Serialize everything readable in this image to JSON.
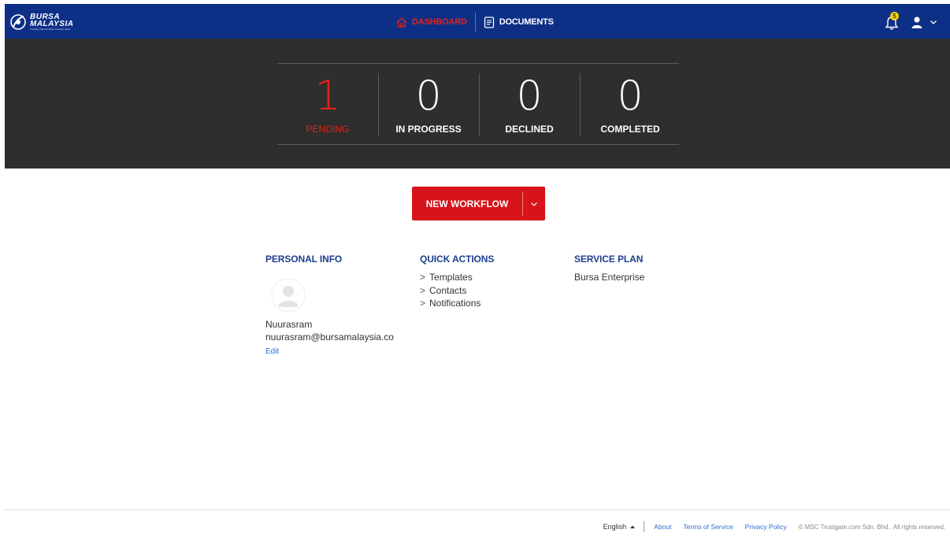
{
  "header": {
    "logo_line1": "BURSA",
    "logo_line2": "MALAYSIA",
    "logo_tagline": "Creating Opportunities, Growing Value",
    "nav": [
      {
        "label": "DASHBOARD",
        "icon": "home-icon",
        "active": true
      },
      {
        "label": "DOCUMENTS",
        "icon": "document-icon",
        "active": false
      }
    ],
    "notification_count": "5",
    "colors": {
      "bar": "#0e2f86",
      "active": "#e2231a",
      "badge": "#f5d20b"
    }
  },
  "stats": [
    {
      "value": "1",
      "label": "PENDING"
    },
    {
      "value": "0",
      "label": "IN PROGRESS"
    },
    {
      "value": "0",
      "label": "DECLINED"
    },
    {
      "value": "0",
      "label": "COMPLETED"
    }
  ],
  "workflow": {
    "label": "NEW WORKFLOW",
    "color": "#d7141a"
  },
  "personal_info": {
    "title": "PERSONAL INFO",
    "name": "Nuurasram",
    "email": "nuurasram@bursamalaysia.co",
    "edit": "Edit"
  },
  "quick_actions": {
    "title": "QUICK ACTIONS",
    "items": [
      {
        "label": "Templates"
      },
      {
        "label": "Contacts"
      },
      {
        "label": "Notifications"
      }
    ]
  },
  "service_plan": {
    "title": "SERVICE PLAN",
    "plan": "Bursa Enterprise"
  },
  "footer": {
    "language": "English",
    "links": [
      "About",
      "Terms of Service",
      "Privacy Policy"
    ],
    "copyright": "© MSC Trustgate.com Sdn. Bhd.. All rights reserved."
  }
}
